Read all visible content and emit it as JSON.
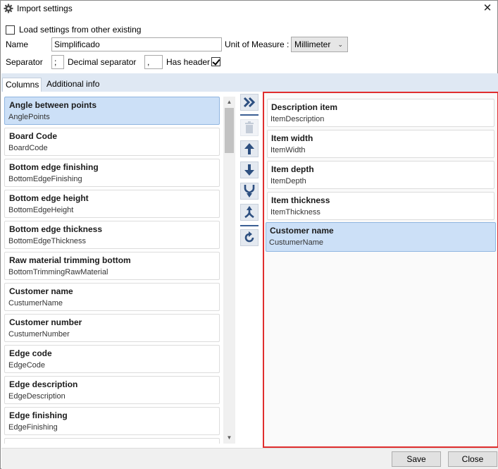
{
  "window": {
    "title": "Import settings",
    "app_icon": "gear-icon",
    "close_label": "✕"
  },
  "settings": {
    "load_existing_label": "Load settings from other existing",
    "load_existing_checked": false,
    "name_label": "Name",
    "name_value": "Simplificado",
    "unit_label": "Unit of Measure :",
    "unit_value": "Millimeter",
    "separator_label": "Separator",
    "separator_value": ";",
    "decimal_label": "Decimal separator",
    "decimal_value": ",",
    "header_label": "Has header",
    "header_checked": true
  },
  "tabs": [
    {
      "label": "Columns",
      "active": true
    },
    {
      "label": "Additional info",
      "active": false
    }
  ],
  "available_columns": [
    {
      "title": "Angle between points",
      "key": "AnglePoints",
      "selected": true
    },
    {
      "title": "Board Code",
      "key": "BoardCode"
    },
    {
      "title": "Bottom edge finishing",
      "key": "BottomEdgeFinishing"
    },
    {
      "title": "Bottom edge height",
      "key": "BottomEdgeHeight"
    },
    {
      "title": "Bottom edge thickness",
      "key": "BottomEdgeThickness"
    },
    {
      "title": "Raw material trimming bottom",
      "key": "BottomTrimmingRawMaterial"
    },
    {
      "title": "Customer name",
      "key": "CustumerName"
    },
    {
      "title": "Customer number",
      "key": "CustumerNumber"
    },
    {
      "title": "Edge code",
      "key": "EdgeCode"
    },
    {
      "title": "Edge description",
      "key": "EdgeDescription"
    },
    {
      "title": "Edge finishing",
      "key": "EdgeFinishing"
    }
  ],
  "selected_columns": [
    {
      "title": "Description item",
      "key": "ItemDescription"
    },
    {
      "title": "Item width",
      "key": "ItemWidth"
    },
    {
      "title": "Item depth",
      "key": "ItemDepth"
    },
    {
      "title": "Item thickness",
      "key": "ItemThickness"
    },
    {
      "title": "Customer name",
      "key": "CustumerName",
      "selected": true
    }
  ],
  "toolbar": [
    {
      "name": "add-all-icon"
    },
    {
      "name": "delete-icon",
      "disabled": true
    },
    {
      "name": "move-up-icon"
    },
    {
      "name": "move-down-icon"
    },
    {
      "name": "merge-icon"
    },
    {
      "name": "split-icon"
    },
    {
      "name": "refresh-icon"
    }
  ],
  "footer": {
    "save_label": "Save",
    "close_label": "Close"
  },
  "colors": {
    "accent": "#3b5f94",
    "selection": "#cce0f7",
    "highlight_border": "#e02e2e"
  }
}
